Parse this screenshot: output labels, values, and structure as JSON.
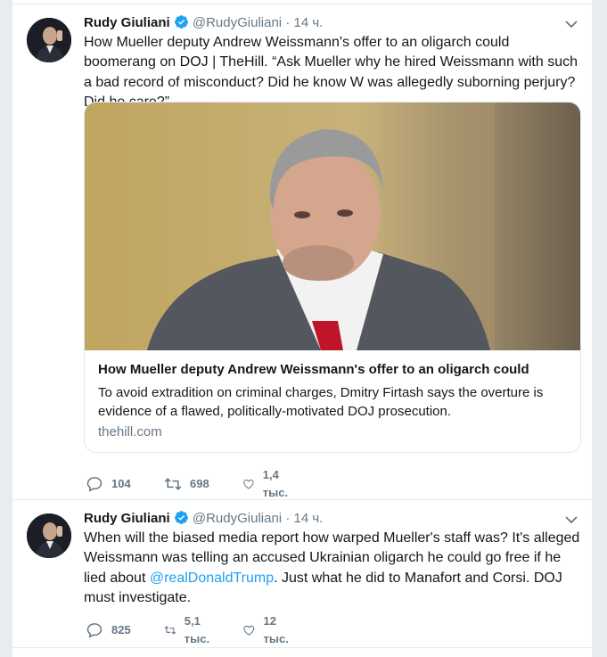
{
  "tweets": [
    {
      "author_name": "Rudy Giuliani",
      "handle": "@RudyGiuliani",
      "separator": "·",
      "time": "14 ч.",
      "text": "How Mueller deputy Andrew Weissmann's offer to an oligarch could boomerang on DOJ | TheHill. “Ask Mueller why he hired Weissmann with such a bad record of misconduct? Did he know W was allegedly suborning perjury? Did he care?”",
      "card": {
        "title": "How Mueller deputy Andrew Weissmann's offer to an oligarch could",
        "description": "To avoid extradition on criminal charges, Dmitry Firtash says the overture is evidence of a flawed, politically-motivated DOJ prosecution.",
        "domain": "thehill.com"
      },
      "replies": "104",
      "retweets": "698",
      "likes": "1,4 тыс."
    },
    {
      "author_name": "Rudy Giuliani",
      "handle": "@RudyGiuliani",
      "separator": "·",
      "time": "14 ч.",
      "text_before": "When will the biased media report how warped Mueller's staff was? It's alleged Weissmann was telling an accused Ukrainian oligarch he could go free if he lied about ",
      "mention": "@realDonaldTrump",
      "text_after": ". Just what he did to Manafort and Corsi. DOJ must investigate.",
      "replies": "825",
      "retweets": "5,1 тыс.",
      "likes": "12 тыс."
    }
  ],
  "colors": {
    "accent": "#1da1f2",
    "secondary_text": "#657786",
    "background": "#e6ecf0"
  },
  "icons": [
    "verified-badge-icon",
    "caret-down-icon",
    "reply-icon",
    "retweet-icon",
    "like-icon"
  ]
}
